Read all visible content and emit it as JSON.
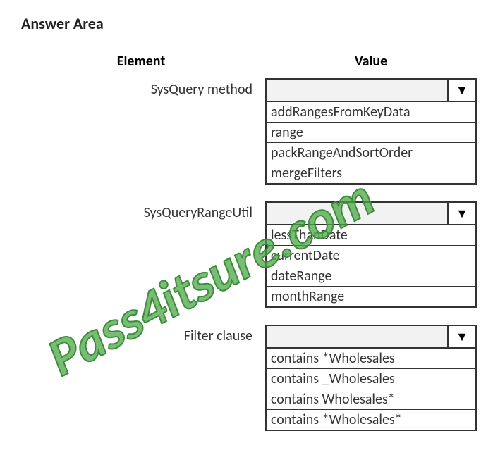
{
  "title": "Answer Area",
  "headers": {
    "element": "Element",
    "value": "Value"
  },
  "rows": [
    {
      "label": "SysQuery method",
      "options": [
        "addRangesFromKeyData",
        "range",
        "packRangeAndSortOrder",
        "mergeFilters"
      ]
    },
    {
      "label": "SysQueryRangeUtil",
      "options": [
        "lessThanDate",
        "currentDate",
        "dateRange",
        "monthRange"
      ]
    },
    {
      "label": "Filter clause",
      "options": [
        "contains *Wholesales",
        "contains _Wholesales",
        "contains Wholesales*",
        "contains *Wholesales*"
      ]
    }
  ],
  "watermark": "Pass4itsure.com"
}
